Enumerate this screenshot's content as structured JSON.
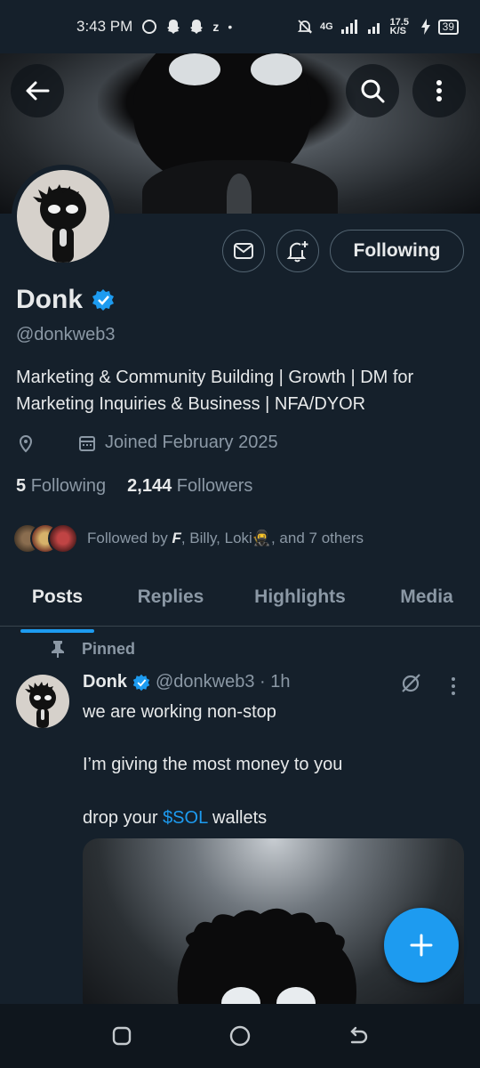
{
  "status_bar": {
    "time": "3:43 PM",
    "network": "4G",
    "speed": "17.5 K/S",
    "battery": "39"
  },
  "header": {
    "back_icon": "arrow-left-icon",
    "search_icon": "search-icon",
    "more_icon": "more-vertical-icon"
  },
  "profile": {
    "name": "Donk",
    "handle": "@donkweb3",
    "bio": "Marketing & Community Building | Growth | DM for Marketing Inquiries & Business | NFA/DYOR",
    "joined": "Joined February 2025",
    "following_count": "5",
    "following_label": "Following",
    "followers_count": "2,144",
    "followers_label": "Followers",
    "followed_by_prefix": "Followed by ",
    "followed_by_name1": "F",
    "followed_by_rest": ", Billy, Loki🥷, and 7 others",
    "follow_button": "Following"
  },
  "tabs": [
    {
      "label": "Posts",
      "active": true
    },
    {
      "label": "Replies",
      "active": false
    },
    {
      "label": "Highlights",
      "active": false
    },
    {
      "label": "Media",
      "active": false
    }
  ],
  "pinned_post": {
    "pinned_label": "Pinned",
    "author": "Donk",
    "handle_time": "@donkweb3 · 1h",
    "line1": "we are working non-stop",
    "line2": "I’m giving the most money to you",
    "line3_before": "drop your ",
    "line3_cashtag": "$SOL",
    "line3_after": " wallets"
  },
  "colors": {
    "accent": "#1d9bf0",
    "background": "#15202b",
    "muted": "#8b98a5"
  }
}
